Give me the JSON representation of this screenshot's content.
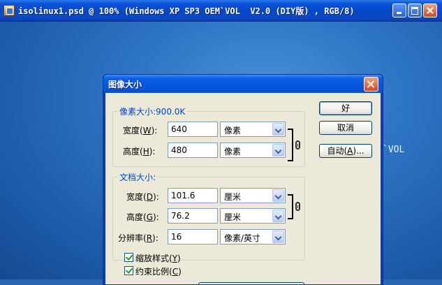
{
  "window": {
    "title": "isolinux1.psd @ 100% (Windows XP SP3 OEM`VOL  V2.0 (DIY版) , RGB/8)",
    "background_text": "`VOL"
  },
  "dialog": {
    "title": "图像大小",
    "pixel_dimensions": {
      "legend": "像素大小:900.0K",
      "width": {
        "label": "宽度(",
        "key": "W",
        "suffix": "):",
        "value": "640",
        "unit": "像素"
      },
      "height": {
        "label": "高度(",
        "key": "H",
        "suffix": "):",
        "value": "480",
        "unit": "像素"
      }
    },
    "document_size": {
      "legend": "文档大小:",
      "width": {
        "label": "宽度(",
        "key": "D",
        "suffix": "):",
        "value": "101.6",
        "unit": "厘米"
      },
      "height": {
        "label": "高度(",
        "key": "G",
        "suffix": "):",
        "value": "76.2",
        "unit": "厘米"
      },
      "resolution": {
        "label": "分辨率(",
        "key": "R",
        "suffix": "):",
        "value": "16",
        "unit": "像素/英寸"
      }
    },
    "buttons": {
      "ok": "好",
      "cancel": "取消",
      "auto_label": "自动(",
      "auto_key": "A",
      "auto_suffix": ")..."
    },
    "options": {
      "scale_styles": {
        "label": "缩放样式(",
        "key": "Y",
        "suffix": ")",
        "checked": true
      },
      "constrain": {
        "label": "约束比例(",
        "key": "C",
        "suffix": ")",
        "checked": true
      }
    }
  },
  "colors": {
    "titlebar": "#0a52d8",
    "dialog_face": "#ece9d8",
    "legend_text": "#0046d5"
  }
}
